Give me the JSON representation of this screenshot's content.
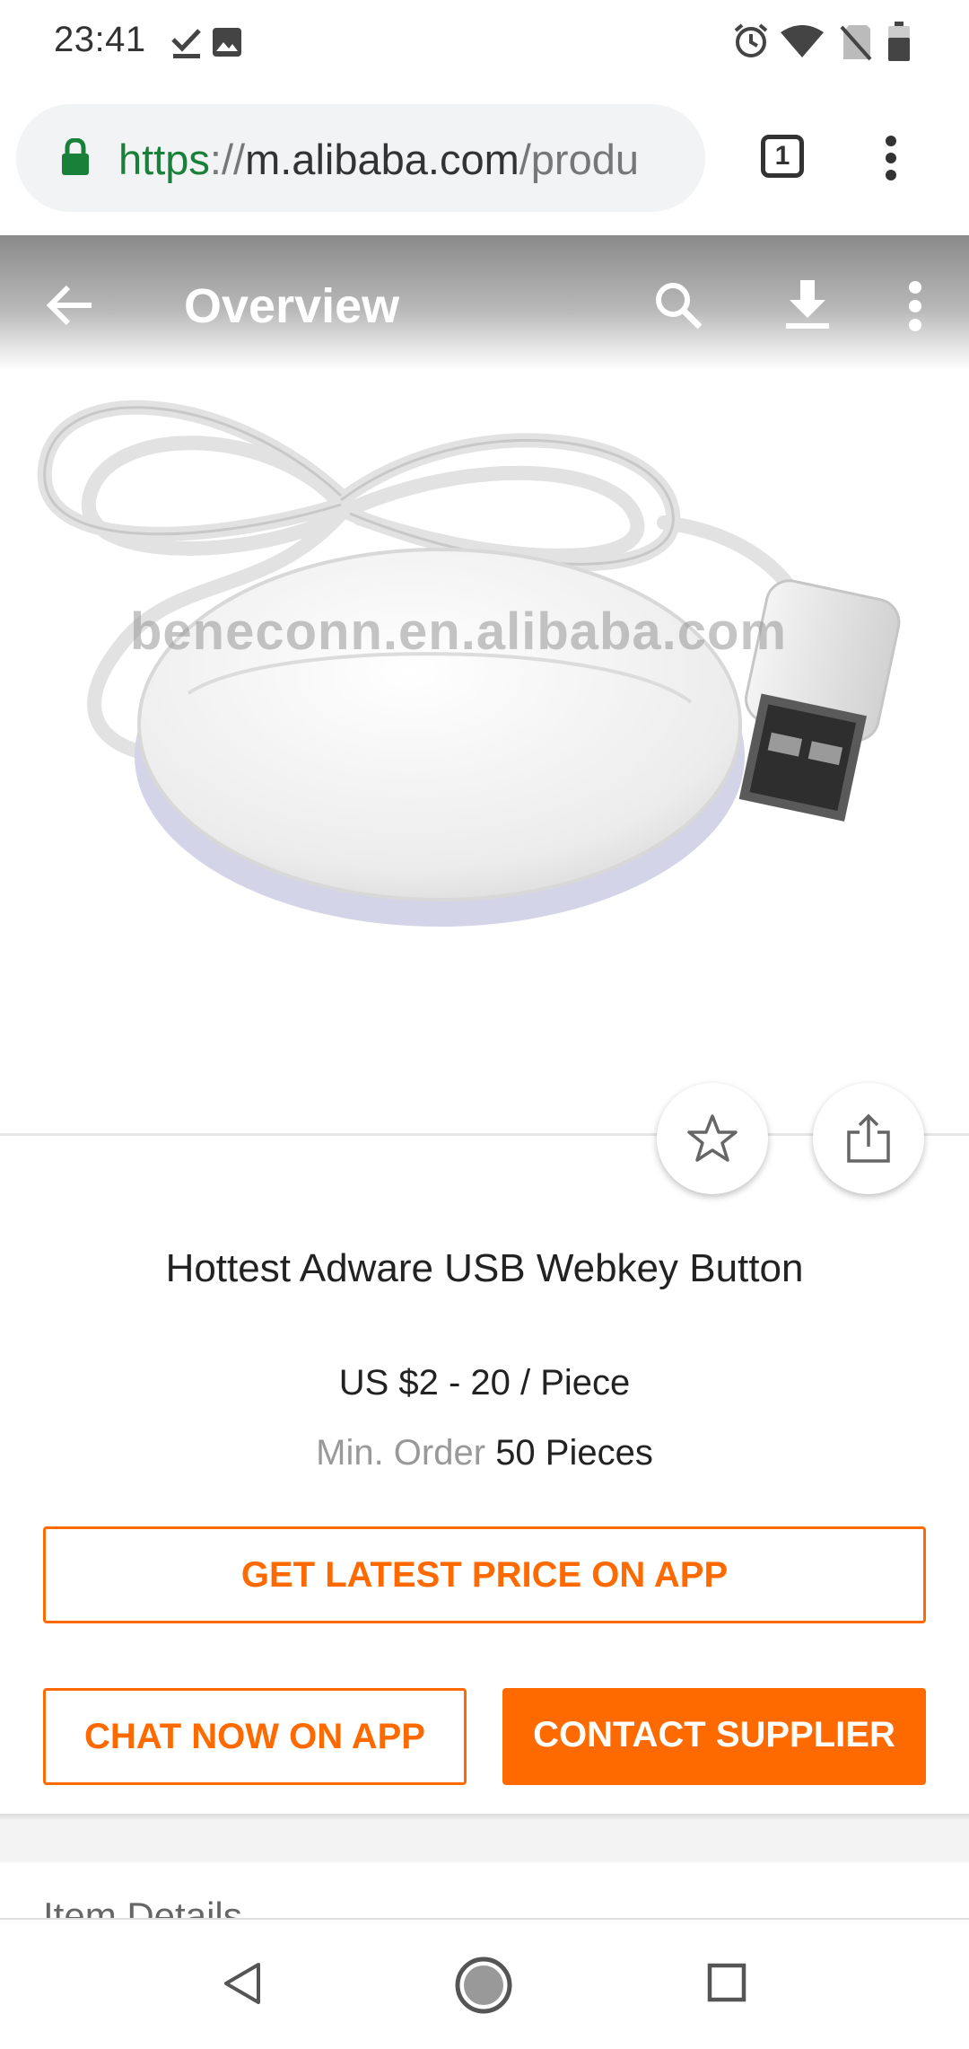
{
  "status_bar": {
    "time": "23:41",
    "icons": [
      "check-download-icon",
      "image-icon",
      "alarm-icon",
      "wifi-icon",
      "no-sim-icon",
      "battery-icon"
    ]
  },
  "browser": {
    "url_scheme": "https",
    "url_sep": "://",
    "url_host": "m.alibaba.com",
    "url_path": "/produ",
    "tab_count": "1"
  },
  "header": {
    "title": "Overview"
  },
  "product": {
    "watermark": "beneconn.en.alibaba.com",
    "title": "Hottest Adware USB Webkey Button",
    "price": "US $2 - 20 / Piece",
    "min_order_label": "Min. Order",
    "min_order_value": "50 Pieces"
  },
  "actions": {
    "get_price": "GET LATEST PRICE ON APP",
    "chat_now": "CHAT NOW ON APP",
    "contact_supplier": "CONTACT SUPPLIER"
  },
  "sections": {
    "item_details": "Item Details"
  },
  "colors": {
    "accent": "#ff6a00",
    "secure_green": "#188038"
  }
}
